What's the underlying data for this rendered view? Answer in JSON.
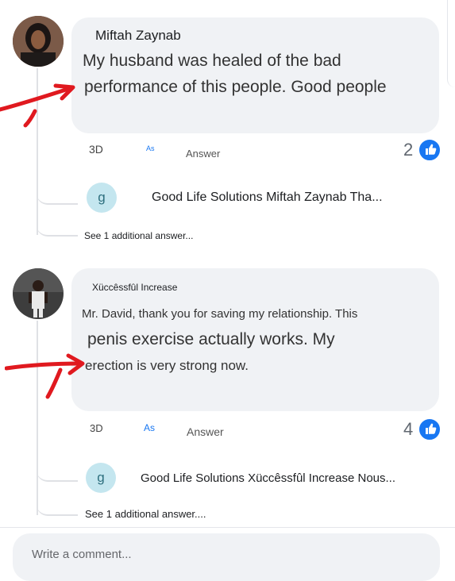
{
  "comments": [
    {
      "author": "Miftah Zaynab",
      "text_line1": "My husband was healed of the bad",
      "text_line2": "performance of this people. Good people",
      "time": "3D",
      "as_label": "As",
      "answer_label": "Answer",
      "likes": "2",
      "reply": {
        "avatar_letter": "g",
        "text": "Good Life Solutions Miftah Zaynab Tha..."
      },
      "see_more": "See 1 additional answer..."
    },
    {
      "author": "Xüccêssfûl Increase",
      "text_line1": "Mr. David, thank you for saving my relationship. This",
      "text_line2": "penis exercise actually works. My",
      "text_line3": "erection is very strong now.",
      "time": "3D",
      "as_label": "As",
      "answer_label": "Answer",
      "likes": "4",
      "reply": {
        "avatar_letter": "g",
        "text": "Good Life Solutions Xüccêssfûl Increase Nous..."
      },
      "see_more": "See 1 additional answer...."
    }
  ],
  "composer": {
    "placeholder": "Write a comment..."
  },
  "colors": {
    "bubble": "#f0f2f5",
    "like_blue": "#1877f2",
    "annotation_arrow": "#e0191f"
  },
  "icons": [
    "thumbs-up-icon",
    "annotation-arrow"
  ]
}
